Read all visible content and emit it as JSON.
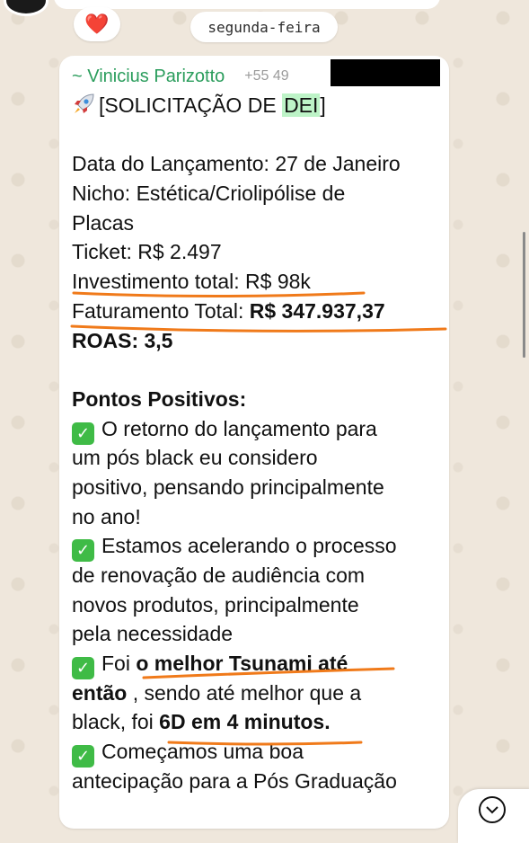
{
  "chat": {
    "reaction_emoji": "❤️",
    "date_divider": "segunda-feira"
  },
  "message": {
    "sender_name": "~ Vinicius Parizotto",
    "sender_phone": "+55 49",
    "title_prefix": "[SOLICITAÇÃO DE ",
    "title_highlight": "DEI",
    "title_suffix": "]",
    "launch_date": "Data do Lançamento: 27 de Janeiro",
    "niche_line1": "Nicho: Estética/Criolipólise de",
    "niche_line2": "Placas",
    "ticket": "Ticket: R$ 2.497",
    "investment": "Investimento total: R$ 98k",
    "revenue_label": "Faturamento Total: ",
    "revenue_value": "R$ 347.937,37",
    "roas": "ROAS: 3,5",
    "positives_heading": "Pontos Positivos:",
    "p1_l1": "O retorno do lançamento para",
    "p1_l2": "um pós black eu considero",
    "p1_l3": "positivo, pensando principalmente",
    "p1_l4": "no ano!",
    "p2_l1": "Estamos acelerando o processo",
    "p2_l2": "de renovação de audiência com",
    "p2_l3": "novos produtos, principalmente",
    "p2_l4": "pela necessidade",
    "p3_pre": "Foi ",
    "p3_bold1": "o melhor Tsunami até",
    "p3_bold2": "então",
    "p3_mid": " , sendo até melhor que a",
    "p3_l3_pre": "black, foi ",
    "p3_bold3": "6D em 4 minutos.",
    "p4_l1": "Começamos uma boa",
    "p4_l2": "antecipação para a Pós Graduação"
  },
  "colors": {
    "sender": "#2a9d5c",
    "annotation_underline": "#f07a1a",
    "check_badge": "#3fbb46",
    "highlight": "#bdf3c7"
  }
}
